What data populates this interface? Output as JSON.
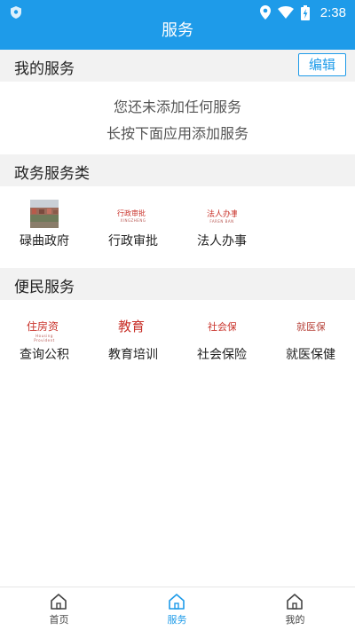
{
  "status_bar": {
    "time": "2:38"
  },
  "app_bar": {
    "title": "服务"
  },
  "my_services": {
    "title": "我的服务",
    "edit_label": "编辑",
    "empty_line1": "您还未添加任何服务",
    "empty_line2": "长按下面应用添加服务"
  },
  "gov_services": {
    "title": "政务服务类",
    "items": [
      {
        "label": "碌曲政府",
        "icon": "city-photo-icon"
      },
      {
        "label": "行政审批",
        "icon": "approval-icon",
        "thumb_text": "行政审批",
        "thumb_sub": "XINGZHENG"
      },
      {
        "label": "法人办事",
        "icon": "legal-person-icon",
        "thumb_text": "法人办事",
        "thumb_sub": "FAREN BAN"
      }
    ]
  },
  "civil_services": {
    "title": "便民服务",
    "items": [
      {
        "label": "查询公积",
        "icon": "housing-fund-icon",
        "thumb_text": "住房资",
        "thumb_sub": "Housing Provident"
      },
      {
        "label": "教育培训",
        "icon": "education-icon",
        "thumb_text": "教育"
      },
      {
        "label": "社会保险",
        "icon": "social-insurance-icon",
        "thumb_text": "社会保"
      },
      {
        "label": "就医保健",
        "icon": "medical-icon",
        "thumb_text": "就医保"
      }
    ]
  },
  "bottom_nav": [
    {
      "label": "首页",
      "icon": "home-icon"
    },
    {
      "label": "服务",
      "icon": "home-icon"
    },
    {
      "label": "我的",
      "icon": "home-icon"
    }
  ],
  "colors": {
    "accent": "#1e9be9",
    "section_bg": "#f2f2f2",
    "thumb_red": "#c9332b"
  }
}
